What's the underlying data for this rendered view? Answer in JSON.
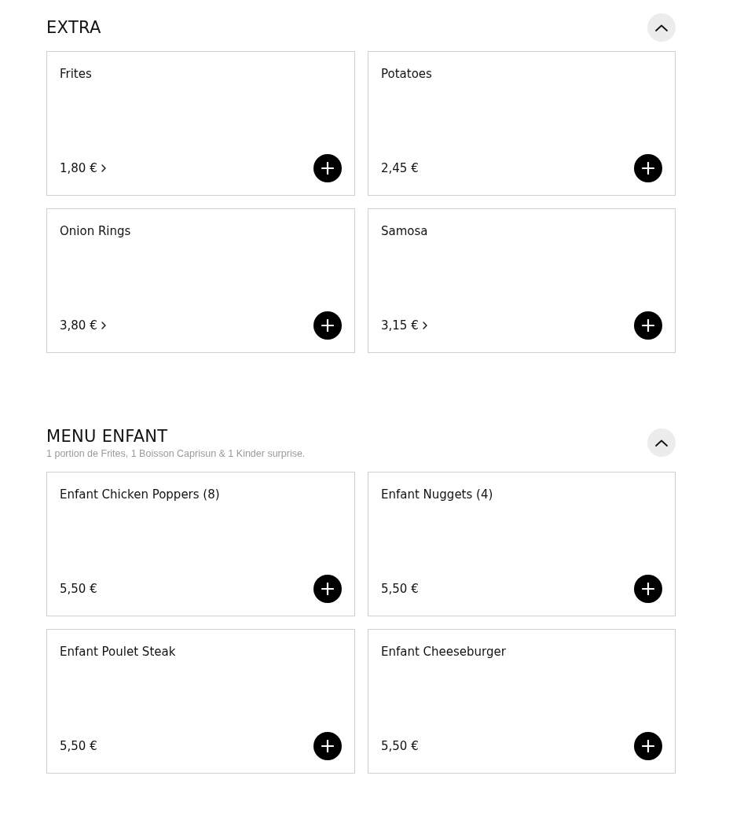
{
  "sections": [
    {
      "title": "EXTRA",
      "expanded": true,
      "items": [
        {
          "name": "Frites",
          "price": "1,80 €",
          "has_options": true
        },
        {
          "name": "Potatoes",
          "price": "2,45 €",
          "has_options": false
        },
        {
          "name": "Onion Rings",
          "price": "3,80 €",
          "has_options": true
        },
        {
          "name": "Samosa",
          "price": "3,15 €",
          "has_options": true
        }
      ]
    },
    {
      "title": "MENU ENFANT",
      "description": "1 portion de Frites, 1 Boisson Caprisun & 1 Kinder surprise.",
      "expanded": true,
      "items": [
        {
          "name": "Enfant Chicken Poppers (8)",
          "price": "5,50 €",
          "has_options": false
        },
        {
          "name": "Enfant Nuggets (4)",
          "price": "5,50 €",
          "has_options": false
        },
        {
          "name": "Enfant Poulet Steak",
          "price": "5,50 €",
          "has_options": false
        },
        {
          "name": "Enfant Cheeseburger",
          "price": "5,50 €",
          "has_options": false
        }
      ]
    }
  ]
}
